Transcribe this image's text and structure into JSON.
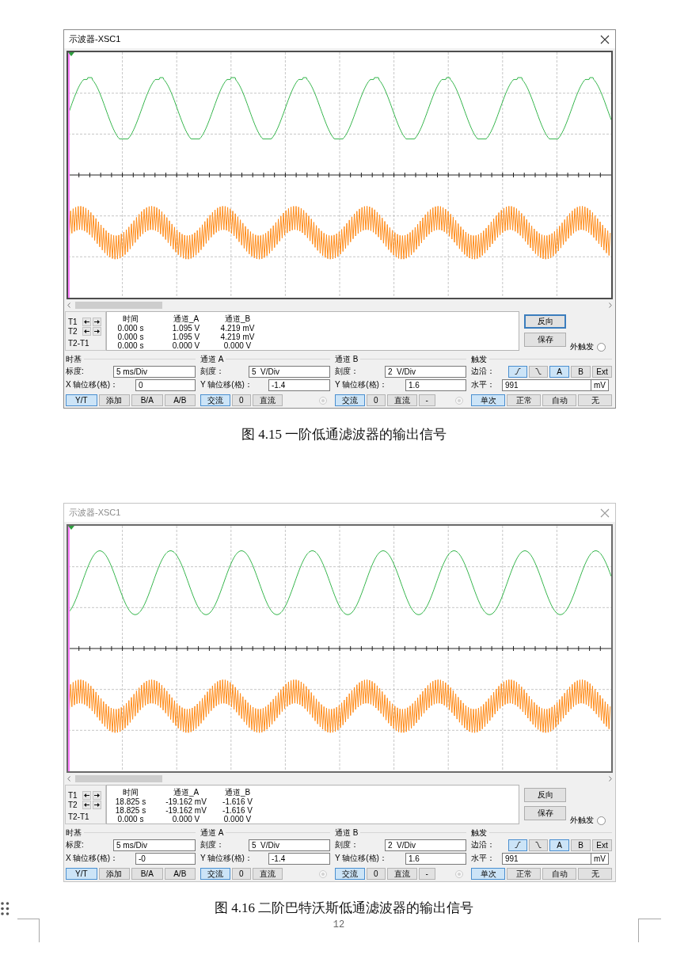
{
  "figures": [
    {
      "window": {
        "title": "示波器-XSC1",
        "active": true
      },
      "screen": {
        "traces": [
          {
            "kind": "notched",
            "color": "#33b54a"
          },
          {
            "kind": "ripple",
            "color": "#ff8c1a"
          }
        ]
      },
      "readout": {
        "cursors": [
          {
            "label": "T1"
          },
          {
            "label": "T2"
          }
        ],
        "difference_label": "T2-T1",
        "columns": [
          "时间",
          "通道_A",
          "通道_B"
        ],
        "rows": [
          [
            "0.000 s",
            "1.095 V",
            "4.219 mV"
          ],
          [
            "0.000 s",
            "1.095 V",
            "4.219 mV"
          ],
          [
            "0.000 s",
            "0.000 V",
            "0.000 V"
          ]
        ]
      },
      "actions": [
        {
          "label": "反向",
          "focused": true
        },
        {
          "label": "保存",
          "focused": false
        }
      ],
      "external_trigger": {
        "label": "外触发",
        "radio": {
          "disabled": false
        }
      },
      "timebase": {
        "title": "时基",
        "fields": [
          {
            "label": "标度:",
            "value": "5 ms/Div"
          },
          {
            "label": "X 轴位移(格)：",
            "value": "0"
          }
        ],
        "buttons": [
          {
            "label": "Y/T",
            "selected": true
          },
          {
            "label": "添加",
            "selected": false
          },
          {
            "label": "B/A",
            "selected": false
          },
          {
            "label": "A/B",
            "selected": false
          }
        ]
      },
      "channel_a": {
        "title": "通道 A",
        "fields": [
          {
            "label": "刻度：",
            "value": "5  V/Div"
          },
          {
            "label": "Y 轴位移(格)：",
            "value": "-1.4"
          }
        ],
        "buttons": [
          {
            "label": "交流",
            "selected": true
          },
          {
            "label": "0",
            "selected": false
          },
          {
            "label": "直流",
            "selected": false
          }
        ],
        "radio": {
          "disabled": true
        }
      },
      "channel_b": {
        "title": "通道 B",
        "fields": [
          {
            "label": "刻度：",
            "value": "2  V/Div"
          },
          {
            "label": "Y 轴位移(格)：",
            "value": "1.6"
          }
        ],
        "buttons": [
          {
            "label": "交流",
            "selected": true
          },
          {
            "label": "0",
            "selected": false
          },
          {
            "label": "直流",
            "selected": false
          },
          {
            "label": "-",
            "selected": false
          }
        ],
        "radio": {
          "disabled": true
        }
      },
      "trigger": {
        "title": "触发",
        "edge_label": "边沿：",
        "edges": [
          {
            "kind": "rising",
            "selected": true
          },
          {
            "kind": "falling",
            "selected": false
          }
        ],
        "sources": [
          {
            "label": "A",
            "selected": true
          },
          {
            "label": "B",
            "selected": false
          },
          {
            "label": "Ext",
            "selected": false
          }
        ],
        "level": {
          "label": "水平：",
          "value": "991",
          "unit": "mV"
        },
        "modes": [
          {
            "label": "单次",
            "selected": true
          },
          {
            "label": "正常",
            "selected": false
          },
          {
            "label": "自动",
            "selected": false
          },
          {
            "label": "无",
            "selected": false
          }
        ]
      },
      "caption": "图 4.15 一阶低通滤波器的输出信号"
    },
    {
      "window": {
        "title": "示波器-XSC1",
        "active": false
      },
      "screen": {
        "traces": [
          {
            "kind": "sine",
            "color": "#33b54a"
          },
          {
            "kind": "ripple",
            "color": "#ff8c1a"
          }
        ]
      },
      "readout": {
        "cursors": [
          {
            "label": "T1"
          },
          {
            "label": "T2"
          }
        ],
        "difference_label": "T2-T1",
        "columns": [
          "时间",
          "通道_A",
          "通道_B"
        ],
        "rows": [
          [
            "18.825 s",
            "-19.162 mV",
            "-1.616 V"
          ],
          [
            "18.825 s",
            "-19.162 mV",
            "-1.616 V"
          ],
          [
            "0.000 s",
            "0.000 V",
            "0.000 V"
          ]
        ]
      },
      "actions": [
        {
          "label": "反向",
          "focused": false
        },
        {
          "label": "保存",
          "focused": false
        }
      ],
      "external_trigger": {
        "label": "外触发",
        "radio": {
          "disabled": false
        }
      },
      "timebase": {
        "title": "时基",
        "fields": [
          {
            "label": "标度:",
            "value": "5 ms/Div"
          },
          {
            "label": "X 轴位移(格)：",
            "value": "-0"
          }
        ],
        "buttons": [
          {
            "label": "Y/T",
            "selected": true
          },
          {
            "label": "添加",
            "selected": false
          },
          {
            "label": "B/A",
            "selected": false
          },
          {
            "label": "A/B",
            "selected": false
          }
        ]
      },
      "channel_a": {
        "title": "通道 A",
        "fields": [
          {
            "label": "刻度：",
            "value": "5  V/Div"
          },
          {
            "label": "Y 轴位移(格)：",
            "value": "-1.4"
          }
        ],
        "buttons": [
          {
            "label": "交流",
            "selected": true
          },
          {
            "label": "0",
            "selected": false
          },
          {
            "label": "直流",
            "selected": false
          }
        ],
        "radio": {
          "disabled": true
        }
      },
      "channel_b": {
        "title": "通道 B",
        "fields": [
          {
            "label": "刻度：",
            "value": "2  V/Div"
          },
          {
            "label": "Y 轴位移(格)：",
            "value": "1.6"
          }
        ],
        "buttons": [
          {
            "label": "交流",
            "selected": true
          },
          {
            "label": "0",
            "selected": false
          },
          {
            "label": "直流",
            "selected": false
          },
          {
            "label": "-",
            "selected": false
          }
        ],
        "radio": {
          "disabled": true
        }
      },
      "trigger": {
        "title": "触发",
        "edge_label": "边沿：",
        "edges": [
          {
            "kind": "rising",
            "selected": true
          },
          {
            "kind": "falling",
            "selected": false
          }
        ],
        "sources": [
          {
            "label": "A",
            "selected": true
          },
          {
            "label": "B",
            "selected": false
          },
          {
            "label": "Ext",
            "selected": false
          }
        ],
        "level": {
          "label": "水平：",
          "value": "991",
          "unit": "mV"
        },
        "modes": [
          {
            "label": "单次",
            "selected": true
          },
          {
            "label": "正常",
            "selected": false
          },
          {
            "label": "自动",
            "selected": false
          },
          {
            "label": "无",
            "selected": false
          }
        ]
      },
      "caption": "图 4.16 二阶巴特沃斯低通滤波器的输出信号"
    }
  ],
  "page_number": "12"
}
